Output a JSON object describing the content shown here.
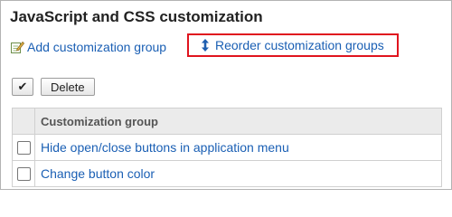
{
  "page": {
    "title": "JavaScript and CSS customization"
  },
  "actions": {
    "add_label": "Add customization group",
    "reorder_label": "Reorder customization groups"
  },
  "toolbar": {
    "check_all_label": "✔",
    "delete_label": "Delete"
  },
  "table": {
    "header": "Customization group",
    "rows": [
      {
        "label": "Hide open/close buttons in application menu"
      },
      {
        "label": "Change button color"
      }
    ]
  },
  "colors": {
    "link": "#1a5fb4",
    "highlight_border": "#e0141e"
  },
  "icons": {
    "add": "edit-pencil-icon",
    "reorder": "up-down-arrow-icon"
  }
}
